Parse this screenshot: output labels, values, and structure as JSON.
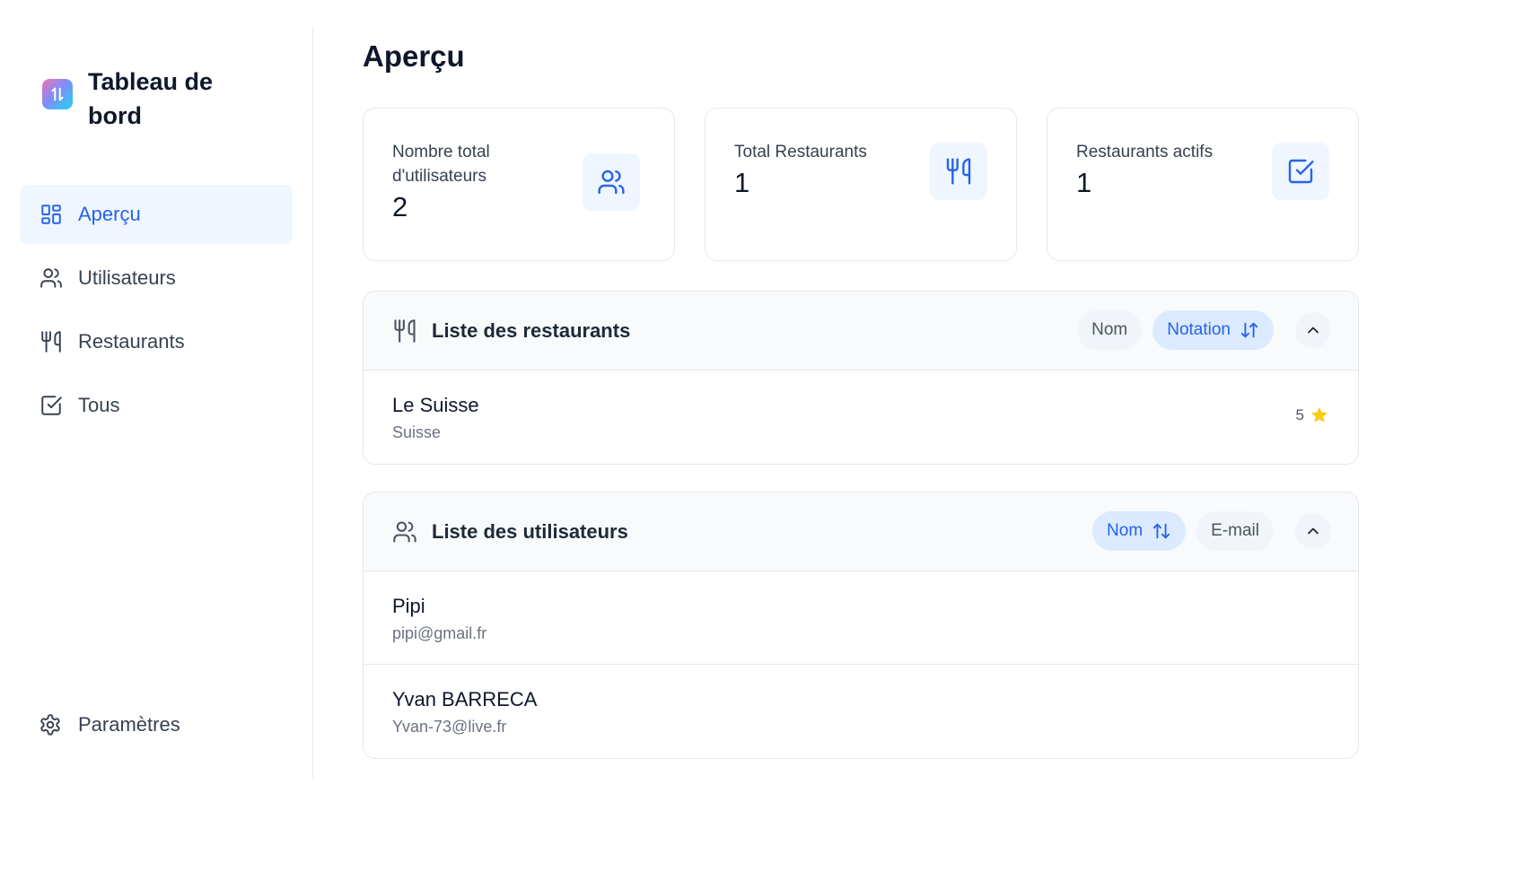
{
  "sidebar": {
    "brand_title": "Tableau de bord",
    "items": [
      {
        "label": "Aperçu",
        "icon": "layout-grid-icon",
        "active": true
      },
      {
        "label": "Utilisateurs",
        "icon": "users-icon",
        "active": false
      },
      {
        "label": "Restaurants",
        "icon": "utensils-icon",
        "active": false
      },
      {
        "label": "Tous",
        "icon": "check-square-icon",
        "active": false
      }
    ],
    "settings_label": "Paramètres"
  },
  "main": {
    "title": "Aperçu",
    "stats": [
      {
        "label": "Nombre total d'utilisateurs",
        "value": "2",
        "icon": "users-icon"
      },
      {
        "label": "Total Restaurants",
        "value": "1",
        "icon": "utensils-icon"
      },
      {
        "label": "Restaurants actifs",
        "value": "1",
        "icon": "check-square-icon"
      }
    ],
    "restaurants_panel": {
      "title": "Liste des restaurants",
      "sort_name": "Nom",
      "sort_rating": "Notation",
      "rows": [
        {
          "name": "Le Suisse",
          "subtitle": "Suisse",
          "rating": "5"
        }
      ]
    },
    "users_panel": {
      "title": "Liste des utilisateurs",
      "sort_name": "Nom",
      "sort_email": "E-mail",
      "rows": [
        {
          "name": "Pipi",
          "email": "pipi@gmail.fr"
        },
        {
          "name": "Yvan BARRECA",
          "email": "Yvan-73@live.fr"
        }
      ]
    }
  },
  "colors": {
    "accent": "#2563eb",
    "accent_bg": "#eff6ff",
    "star": "#facc15",
    "border": "#e5e7eb"
  }
}
